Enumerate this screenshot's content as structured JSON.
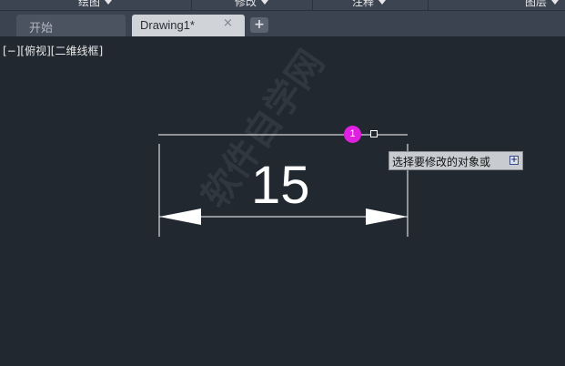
{
  "ribbon": {
    "panels": [
      {
        "label": "绘图"
      },
      {
        "label": "修改"
      },
      {
        "label": "注释"
      },
      {
        "label": "图层"
      }
    ]
  },
  "tabs": {
    "start_label": "开始",
    "drawing_label": "Drawing1*",
    "close_glyph": "×",
    "add_glyph": "+"
  },
  "viewport": {
    "controls": "[−]",
    "view": "[俯视]",
    "visual_style": "[二维线框]"
  },
  "drawing": {
    "dimension_text": "15",
    "grip_number": "1",
    "line_color": "#ffffff",
    "grip_color": "#e020e0",
    "background": "#212830"
  },
  "command_prompt": {
    "text": "选择要修改的对象或",
    "button_glyph": "+"
  },
  "watermark": {
    "text": "软件自学网"
  }
}
